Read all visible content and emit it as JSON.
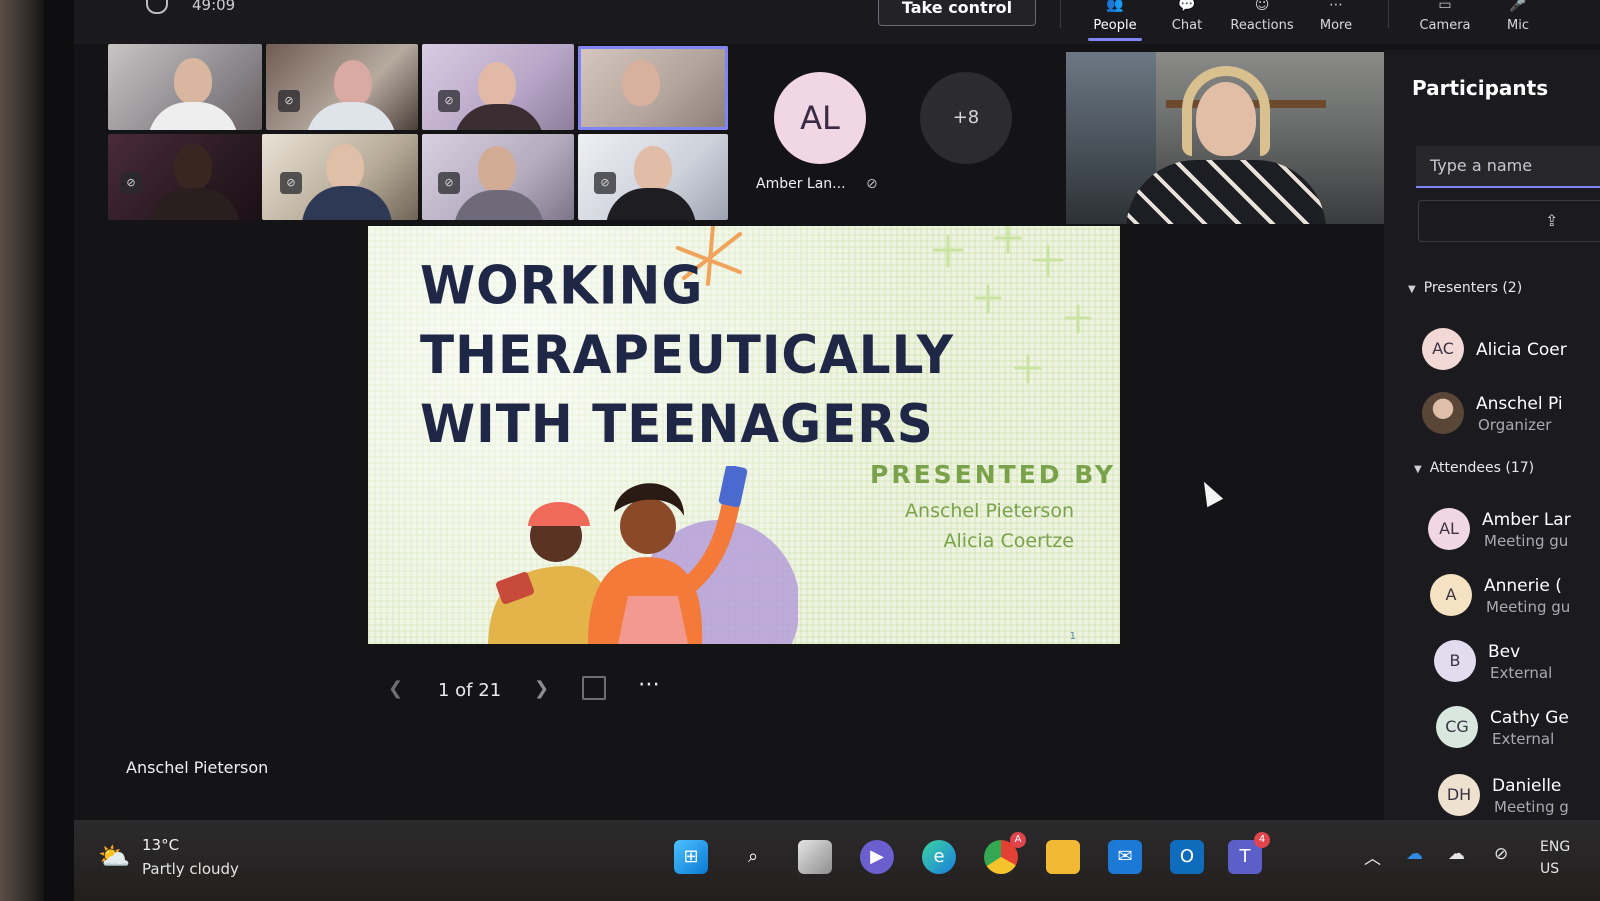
{
  "meeting": {
    "timer": "49:09",
    "take_control": "Take control"
  },
  "toolbar": [
    {
      "label": "People",
      "glyph": "👥",
      "icon": "people-icon",
      "active": true
    },
    {
      "label": "Chat",
      "glyph": "💬",
      "icon": "chat-icon",
      "active": false
    },
    {
      "label": "Reactions",
      "glyph": "☺",
      "icon": "reactions-icon",
      "active": false
    },
    {
      "label": "More",
      "glyph": "⋯",
      "icon": "more-icon",
      "active": false
    },
    {
      "label": "Camera",
      "glyph": "▭",
      "icon": "camera-icon",
      "active": false
    },
    {
      "label": "Mic",
      "glyph": "🎤",
      "icon": "mic-icon",
      "active": false
    }
  ],
  "gallery": {
    "amber_initials": "AL",
    "amber_name": "Amber Lan...",
    "overflow": "+8"
  },
  "slide": {
    "title_lines": [
      "WORKING",
      "THERAPEUTICALLY",
      "WITH TEENAGERS"
    ],
    "presented_by": "PRESENTED BY",
    "presenters": [
      "Anschel Pieterson",
      "Alicia Coertze"
    ],
    "page_marker": "1",
    "counter": "1 of 21"
  },
  "stage": {
    "presenter_name": "Anschel Pieterson"
  },
  "participants_panel": {
    "title": "Participants",
    "search_placeholder": "Type a name",
    "presenters_header": "Presenters (2)",
    "presenters": [
      {
        "initials": "AC",
        "name": "Alicia Coer",
        "role": "",
        "color": "#f2d9d6"
      },
      {
        "initials": "",
        "name": "Anschel Pi",
        "role": "Organizer",
        "color": "#8a7a6a"
      }
    ],
    "attendees_header": "Attendees (17)",
    "attendees": [
      {
        "initials": "AL",
        "name": "Amber Lar",
        "role": "Meeting gu",
        "color": "#f1d6e4"
      },
      {
        "initials": "A",
        "name": "Annerie (",
        "role": "Meeting gu",
        "color": "#f4e2c2"
      },
      {
        "initials": "B",
        "name": "Bev",
        "role": "External",
        "color": "#e3dcef"
      },
      {
        "initials": "CG",
        "name": "Cathy Ge",
        "role": "External",
        "color": "#d9e8df"
      },
      {
        "initials": "DH",
        "name": "Danielle",
        "role": "Meeting g",
        "color": "#eee1cf"
      }
    ]
  },
  "taskbar": {
    "temperature": "13°C",
    "weather": "Partly cloudy",
    "lang_top": "ENG",
    "lang_bottom": "US"
  }
}
